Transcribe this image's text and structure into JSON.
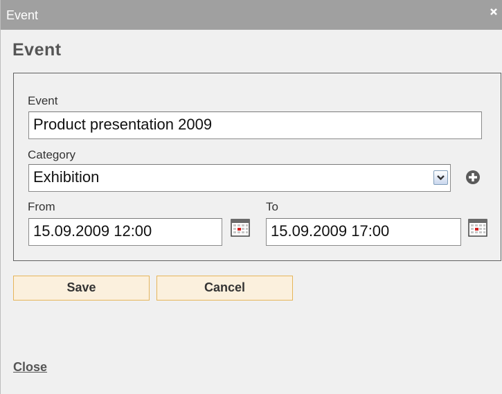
{
  "window": {
    "title": "Event"
  },
  "heading": "Event",
  "form": {
    "event": {
      "label": "Event",
      "value": "Product presentation 2009"
    },
    "category": {
      "label": "Category",
      "selected": "Exhibition"
    },
    "from": {
      "label": "From",
      "value": "15.09.2009 12:00"
    },
    "to": {
      "label": "To",
      "value": "15.09.2009 17:00"
    }
  },
  "buttons": {
    "save": "Save",
    "cancel": "Cancel"
  },
  "footer": {
    "close_link": "Close"
  },
  "icons": {
    "window_close": "close-icon",
    "dropdown": "chevron-down-icon",
    "add_category": "plus-circle-icon",
    "calendar": "calendar-icon"
  },
  "colors": {
    "titlebar": "#a0a0a0",
    "background": "#f0f0f0",
    "button_fill": "#fbf0dd",
    "button_border": "#e6b55a"
  }
}
